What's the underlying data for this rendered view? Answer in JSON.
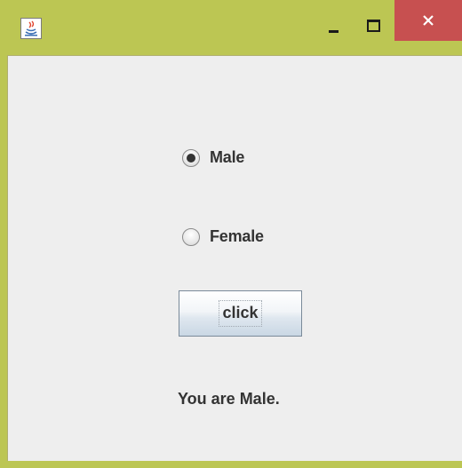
{
  "window": {
    "icon": "java-cup-icon",
    "controls": {
      "minimize_icon": "minimize-icon",
      "maximize_icon": "maximize-icon",
      "close_icon": "close-icon",
      "close_color": "#c75050"
    },
    "frame_color": "#bcc653"
  },
  "form": {
    "gender_options": [
      {
        "label": "Male",
        "selected": true
      },
      {
        "label": "Female",
        "selected": false
      }
    ],
    "button_label": "click",
    "result_text": "You are Male."
  }
}
